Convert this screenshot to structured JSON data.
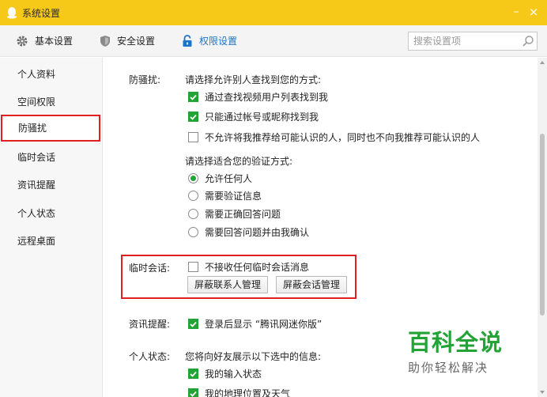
{
  "window": {
    "title": "系统设置",
    "minimize": "–",
    "close": "×"
  },
  "toolbar": {
    "tabs": [
      {
        "label": "基本设置",
        "icon": "gear-icon"
      },
      {
        "label": "安全设置",
        "icon": "shield-icon"
      },
      {
        "label": "权限设置",
        "icon": "lock-icon",
        "active": true
      }
    ],
    "search_placeholder": "搜索设置项"
  },
  "sidebar": {
    "items": [
      {
        "label": "个人资料"
      },
      {
        "label": "空间权限"
      },
      {
        "label": "防骚扰",
        "active": true
      },
      {
        "label": "临时会话"
      },
      {
        "label": "资讯提醒"
      },
      {
        "label": "个人状态"
      },
      {
        "label": "远程桌面"
      }
    ]
  },
  "harass": {
    "label": "防骚扰:",
    "find_prompt": "请选择允许别人查找到您的方式:",
    "find_options": [
      {
        "label": "通过查找视频用户列表找到我",
        "checked": true
      },
      {
        "label": "只能通过帐号或昵称找到我",
        "checked": true
      },
      {
        "label": "不允许将我推荐给可能认识的人，同时也不向我推荐可能认识的人",
        "checked": false
      }
    ],
    "verify_prompt": "请选择适合您的验证方式:",
    "verify_options": [
      {
        "label": "允许任何人",
        "selected": true
      },
      {
        "label": "需要验证信息",
        "selected": false
      },
      {
        "label": "需要正确回答问题",
        "selected": false
      },
      {
        "label": "需要回答问题并由我确认",
        "selected": false
      }
    ]
  },
  "temp_session": {
    "label": "临时会话:",
    "option": {
      "label": "不接收任何临时会话消息",
      "checked": false
    },
    "block_contacts_button": "屏蔽联系人管理",
    "block_sessions_button": "屏蔽会话管理"
  },
  "news": {
    "label": "资讯提醒:",
    "option": {
      "label": "登录后显示 “腾讯网迷你版”",
      "checked": true
    }
  },
  "status": {
    "label": "个人状态:",
    "prompt": "您将向好友展示以下选中的信息:",
    "options": [
      {
        "label": "我的输入状态",
        "checked": true
      },
      {
        "label": "我的地理位置及天气",
        "checked": true
      }
    ]
  },
  "watermark": {
    "line1": "百科全说",
    "line2": "助你轻松解决"
  },
  "colors": {
    "titlebar": "#f6c817",
    "accent": "#1d75c9",
    "check": "#22a336",
    "highlight": "#e02020"
  }
}
